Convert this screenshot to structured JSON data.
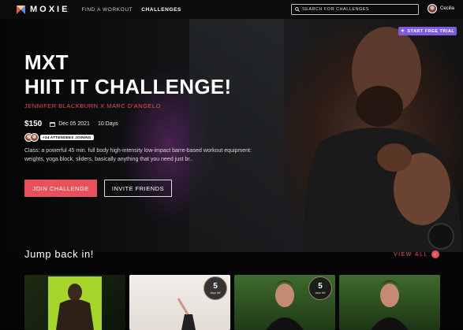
{
  "brand": {
    "name": "MOXIE"
  },
  "nav": [
    {
      "label": "FIND A WORKOUT",
      "active": false
    },
    {
      "label": "CHALLENGES",
      "active": true
    }
  ],
  "search": {
    "placeholder": "SEARCH FOR CHALLENGES"
  },
  "user": {
    "name": "Cecilia"
  },
  "hero": {
    "trial_label": "START FREE TRIAL",
    "title_line1": "MXT",
    "title_line2": "HIIT IT CHALLENGE!",
    "subtitle": "JENNIFER BLACKBURN X MARC D'ANGELO",
    "price": "$150",
    "date": "Dec 05 2021",
    "duration": "10 Days",
    "attendees_label": "+34 ATTENDEES JOINING",
    "description": "Class: a powerful 45 min. full body high-intensity low-impact barre-based workout equipment: weights, yoga block, sliders, basically anything that you need just br..",
    "join_label": "JOIN CHALLENGE",
    "invite_label": "INVITE FRIENDS"
  },
  "jump_back": {
    "title": "Jump back in!",
    "view_all": "VIEW ALL",
    "cards": [
      {
        "days": "",
        "days_label": ""
      },
      {
        "days": "5",
        "days_label": "days left"
      },
      {
        "days": "5",
        "days_label": "days left"
      },
      {
        "days": "",
        "days_label": ""
      }
    ]
  },
  "colors": {
    "accent": "#e8505c",
    "trial": "#7e5be3",
    "background": "#000000"
  }
}
